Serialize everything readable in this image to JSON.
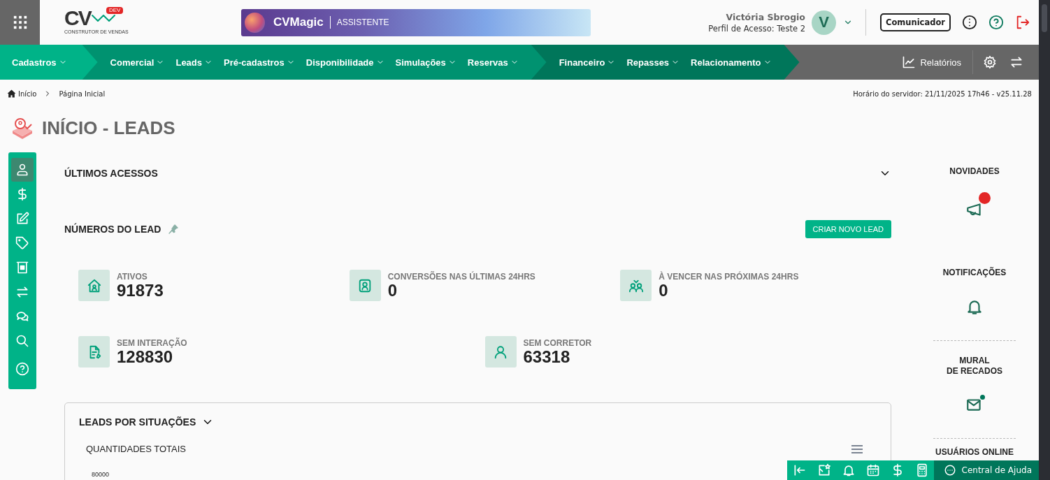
{
  "header": {
    "logo": {
      "mark": "CV",
      "badge": "DEV",
      "tagline": "CONSTRUTOR DE VENDAS"
    },
    "assistant": {
      "name": "CVMagic",
      "label": "ASSISTENTE"
    },
    "user": {
      "name": "Victória Sbrogio",
      "profile": "Perfil de Acesso: Teste 2",
      "initial": "V"
    },
    "communicator_button": "Comunicador"
  },
  "nav": {
    "segments": [
      {
        "kind": "light",
        "items": [
          "Cadastros"
        ]
      },
      {
        "kind": "medium",
        "items": [
          "Comercial",
          "Leads",
          "Pré-cadastros",
          "Disponibilidade",
          "Simulações",
          "Reservas"
        ]
      },
      {
        "kind": "dark",
        "items": [
          "Financeiro",
          "Repasses",
          "Relacionamento"
        ]
      }
    ],
    "reports": "Relatórios"
  },
  "breadcrumb": {
    "items": [
      "Início",
      "Página Inicial"
    ],
    "server_time": "Horário do servidor: 21/11/2025 17h46 - v25.11.28"
  },
  "page_title": "INÍCIO - LEADS",
  "sidebar": {
    "items": [
      {
        "selected": true
      },
      {
        "selected": false
      },
      {
        "selected": false
      },
      {
        "selected": false
      },
      {
        "selected": false
      },
      {
        "selected": false
      },
      {
        "selected": false
      },
      {
        "selected": false
      },
      {
        "selected": false
      }
    ]
  },
  "recent_access": {
    "title": "ÚLTIMOS ACESSOS",
    "expanded": false
  },
  "lead_numbers": {
    "title": "NÚMEROS DO LEAD",
    "button": "CRIAR NOVO LEAD",
    "rows": [
      [
        {
          "kind": "active",
          "label": "ATIVOS",
          "value": "91873"
        },
        {
          "kind": "conversions",
          "label": "CONVERSÕES NAS ÚLTIMAS 24HRS",
          "value": "0"
        },
        {
          "kind": "expiring",
          "label": "À VENCER NAS PRÓXIMAS 24HRS",
          "value": "0"
        }
      ],
      [
        {
          "kind": "no_interaction",
          "label": "SEM INTERAÇÃO",
          "value": "128830"
        },
        {
          "kind": "no_broker",
          "label": "SEM CORRETOR",
          "value": "63318"
        }
      ]
    ]
  },
  "situations_card": {
    "title": "LEADS POR SITUAÇÕES",
    "subtitle": "QUANTIDADES TOTAIS",
    "y_axis_label": "80000"
  },
  "right_panel": [
    {
      "kind": "news",
      "title": "NOVIDADES",
      "unread": true
    },
    {
      "kind": "notifications",
      "title": "NOTIFICAÇÕES",
      "unread": false
    },
    {
      "kind": "mural",
      "title": "MURAL\nDE RECADOS",
      "unread": true
    },
    {
      "kind": "online",
      "title": "USUÁRIOS ONLINE",
      "unread": false
    }
  ],
  "bottom_bar": {
    "help": "Central de Ajuda"
  }
}
